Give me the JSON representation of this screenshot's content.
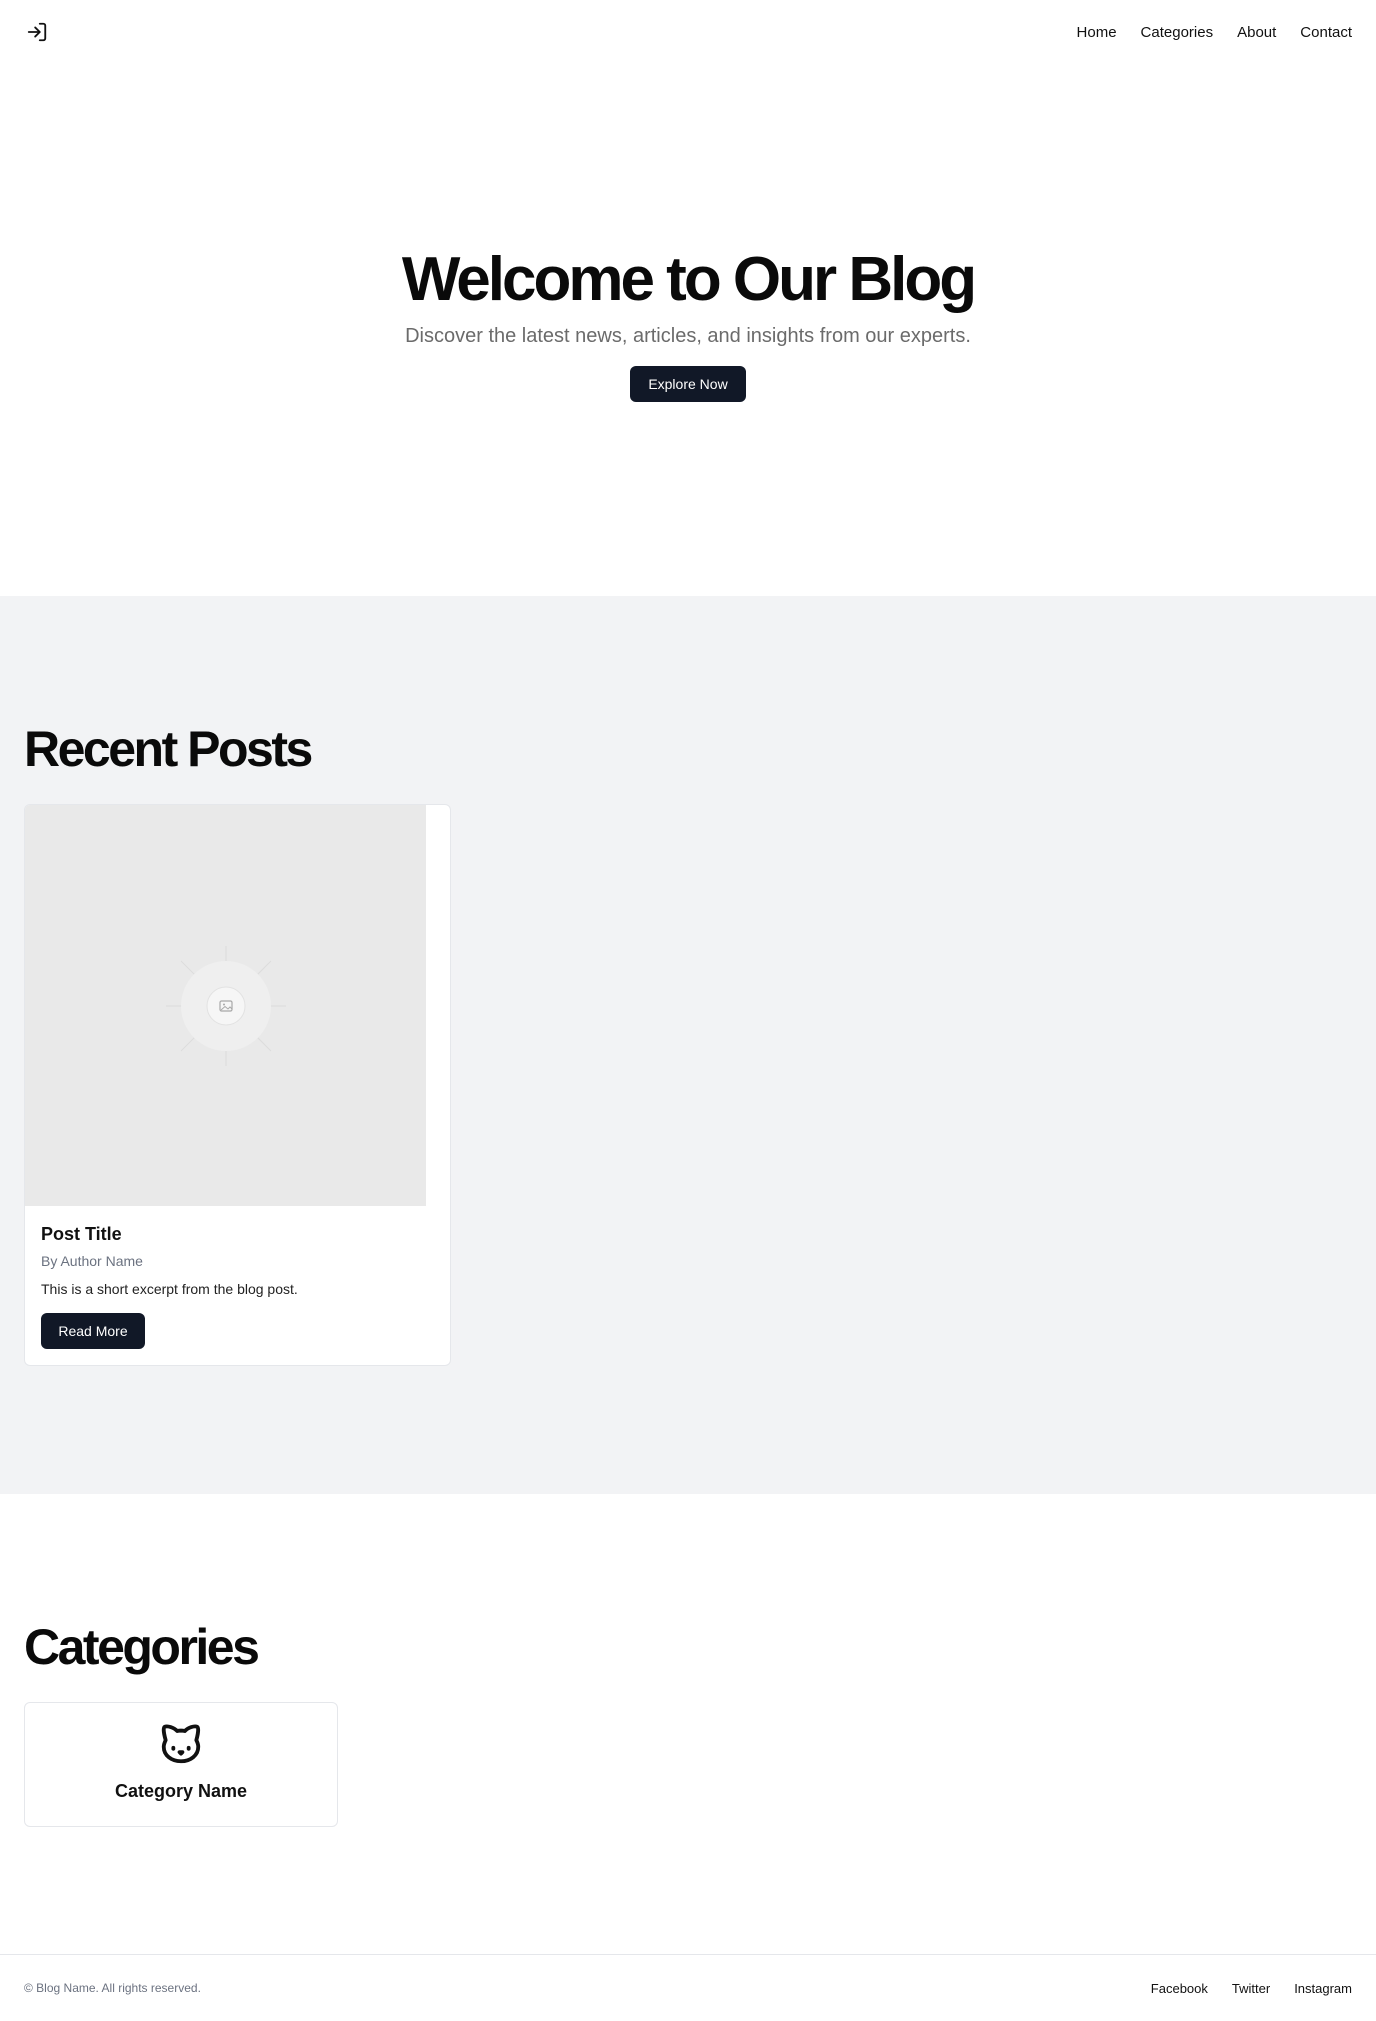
{
  "header": {
    "login_icon": "log-in-icon",
    "nav": [
      {
        "label": "Home"
      },
      {
        "label": "Categories"
      },
      {
        "label": "About"
      },
      {
        "label": "Contact"
      }
    ]
  },
  "hero": {
    "title": "Welcome to Our Blog",
    "subtitle": "Discover the latest news, articles, and insights from our experts.",
    "cta_label": "Explore Now"
  },
  "recent_posts": {
    "heading": "Recent Posts",
    "posts": [
      {
        "image_icon": "image-placeholder-icon",
        "title": "Post Title",
        "author": "By Author Name",
        "excerpt": "This is a short excerpt from the blog post.",
        "button_label": "Read More"
      }
    ]
  },
  "categories": {
    "heading": "Categories",
    "items": [
      {
        "icon": "cat-icon",
        "name": "Category Name"
      }
    ]
  },
  "footer": {
    "copyright": "© Blog Name. All rights reserved.",
    "social": [
      {
        "label": "Facebook"
      },
      {
        "label": "Twitter"
      },
      {
        "label": "Instagram"
      }
    ]
  },
  "colors": {
    "button_bg": "#111827",
    "section_bg": "#f2f3f5",
    "muted_text": "#6b7280"
  }
}
